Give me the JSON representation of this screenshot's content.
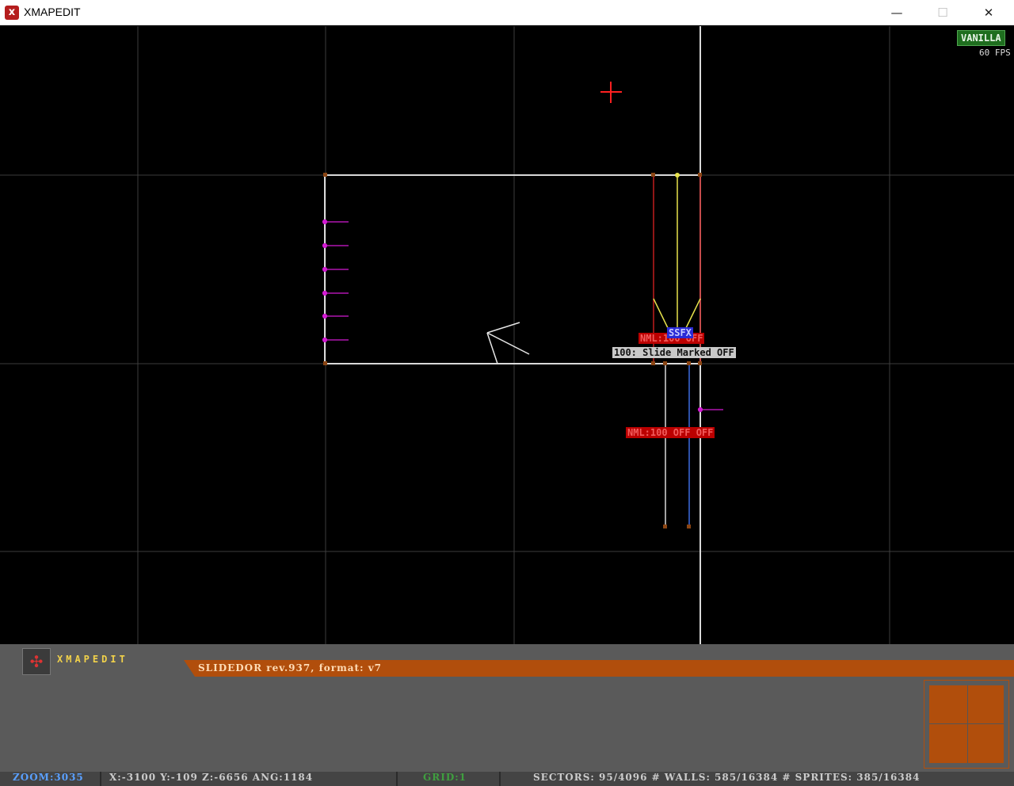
{
  "window": {
    "title": "XMAPEDIT",
    "app_icon": "x-app-icon",
    "minimize_icon": "—",
    "maximize_icon": "☐",
    "close_icon": "✕"
  },
  "hud": {
    "mode_badge": "VANILLA",
    "fps": "60 FPS"
  },
  "map": {
    "sprite_labels": {
      "nml_top": "NML:100 OFF",
      "ssfx": "SSFX",
      "slide": "100: Slide Marked OFF",
      "nml_bottom": "NML:100 OFF OFF"
    },
    "colors": {
      "grid": "#3d3d3d",
      "wall": "#d9d9d9",
      "red_wall": "#c01d1d",
      "yellow_wall": "#e8e34c",
      "blue_wall": "#3c6ce0",
      "sprite": "#d21ad2",
      "cursor": "#ff2020"
    }
  },
  "panel": {
    "logo_text": "XMAPEDIT",
    "info": "SLIDEDOR rev.937, format: v7",
    "accent": "#b14e0c"
  },
  "status": {
    "zoom": "ZOOM:3035",
    "coords": "X:-3100  Y:-109   Z:-6656  ANG:1184",
    "grid": "GRID:1",
    "counts": "SECTORS: 95/4096 # WALLS: 585/16384 # SPRITES: 385/16384"
  }
}
